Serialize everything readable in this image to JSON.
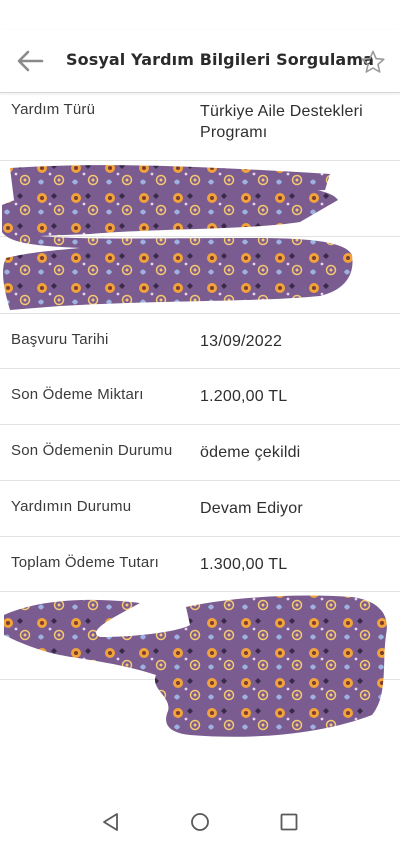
{
  "app_bar": {
    "title": "Sosyal Yardım Bilgileri Sorgulama",
    "back_icon": "arrow-left-icon",
    "favorite_icon": "star-outline-icon"
  },
  "details": [
    {
      "label": "Yardım Türü",
      "value": "Türkiye Aile Destekleri Programı"
    },
    {
      "label": "Başvuru Tarihi",
      "value": "13/09/2022"
    },
    {
      "label": "Son Ödeme Miktarı",
      "value": "1.200,00 TL"
    },
    {
      "label": "Son Ödemenin Durumu",
      "value": "ödeme çekildi"
    },
    {
      "label": "Yardımın Durumu",
      "value": "Devam Ediyor"
    },
    {
      "label": "Toplam Ödeme Tutarı",
      "value": "1.300,00 TL"
    }
  ],
  "nav_bar": {
    "back_icon": "triangle-back-icon",
    "home_icon": "circle-home-icon",
    "recents_icon": "square-recents-icon"
  },
  "colors": {
    "redaction_purple": "#7a5c90",
    "redaction_orange": "#f0a23c",
    "divider": "#e2e2e2"
  }
}
